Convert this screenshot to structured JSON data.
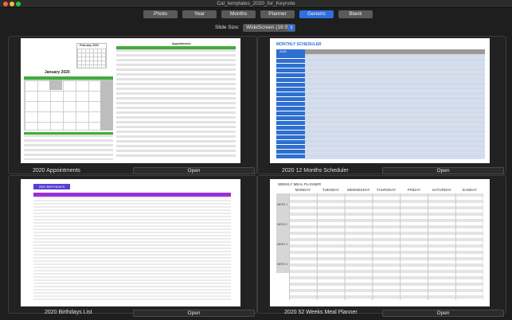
{
  "window": {
    "title": "Cal_templates_2020_for_Keynote"
  },
  "tabs": [
    {
      "label": "Photo",
      "active": false
    },
    {
      "label": "Year",
      "active": false
    },
    {
      "label": "Months",
      "active": false
    },
    {
      "label": "Planner",
      "active": false
    },
    {
      "label": "Generic",
      "active": true
    },
    {
      "label": "Blank",
      "active": false
    }
  ],
  "slide_size": {
    "label": "Slide Size:",
    "value": "WideScreen (16:9)"
  },
  "templates": [
    {
      "name": "2020 Appointments",
      "open_label": "Open",
      "thumb": {
        "month_title": "January 2020",
        "mini_title": "February 2020",
        "side_title": "Appointments",
        "accent": "#3fae3a"
      }
    },
    {
      "name": "2020 12 Months Scheduler",
      "open_label": "Open",
      "thumb": {
        "title": "MONTHLY SCHEDULER",
        "year": "2020",
        "months": [
          "January",
          "February",
          "March",
          "April",
          "May",
          "June",
          "July",
          "August",
          "September",
          "October",
          "November",
          "December"
        ],
        "accent": "#2e6fd1",
        "row_alt": "#cfe0f7"
      }
    },
    {
      "name": "2020 Birthdays List",
      "open_label": "Open",
      "thumb": {
        "title": "2020 BIRTHDAYS",
        "months": [
          "JANUARY",
          "FEBRUARY",
          "MARCH",
          "APRIL",
          "MAY",
          "JUNE",
          "JULY",
          "AUGUST",
          "SEPTEMBER",
          "OCTOBER",
          "NOVEMBER",
          "DECEMBER"
        ],
        "accent": "#9b30d6",
        "title_bg": "#5a3cd8"
      }
    },
    {
      "name": "2020 52 Weeks Meal Planner",
      "open_label": "Open",
      "thumb": {
        "title": "WEEKLY MEAL PLANNER",
        "days": [
          "MONDAY",
          "TUESDAY",
          "WEDNESDAY",
          "THURSDAY",
          "FRIDAY",
          "SATURDAY",
          "SUNDAY"
        ],
        "weeks": [
          "WEEK 1",
          "WEEK 2",
          "WEEK 3",
          "WEEK 4"
        ]
      }
    }
  ]
}
